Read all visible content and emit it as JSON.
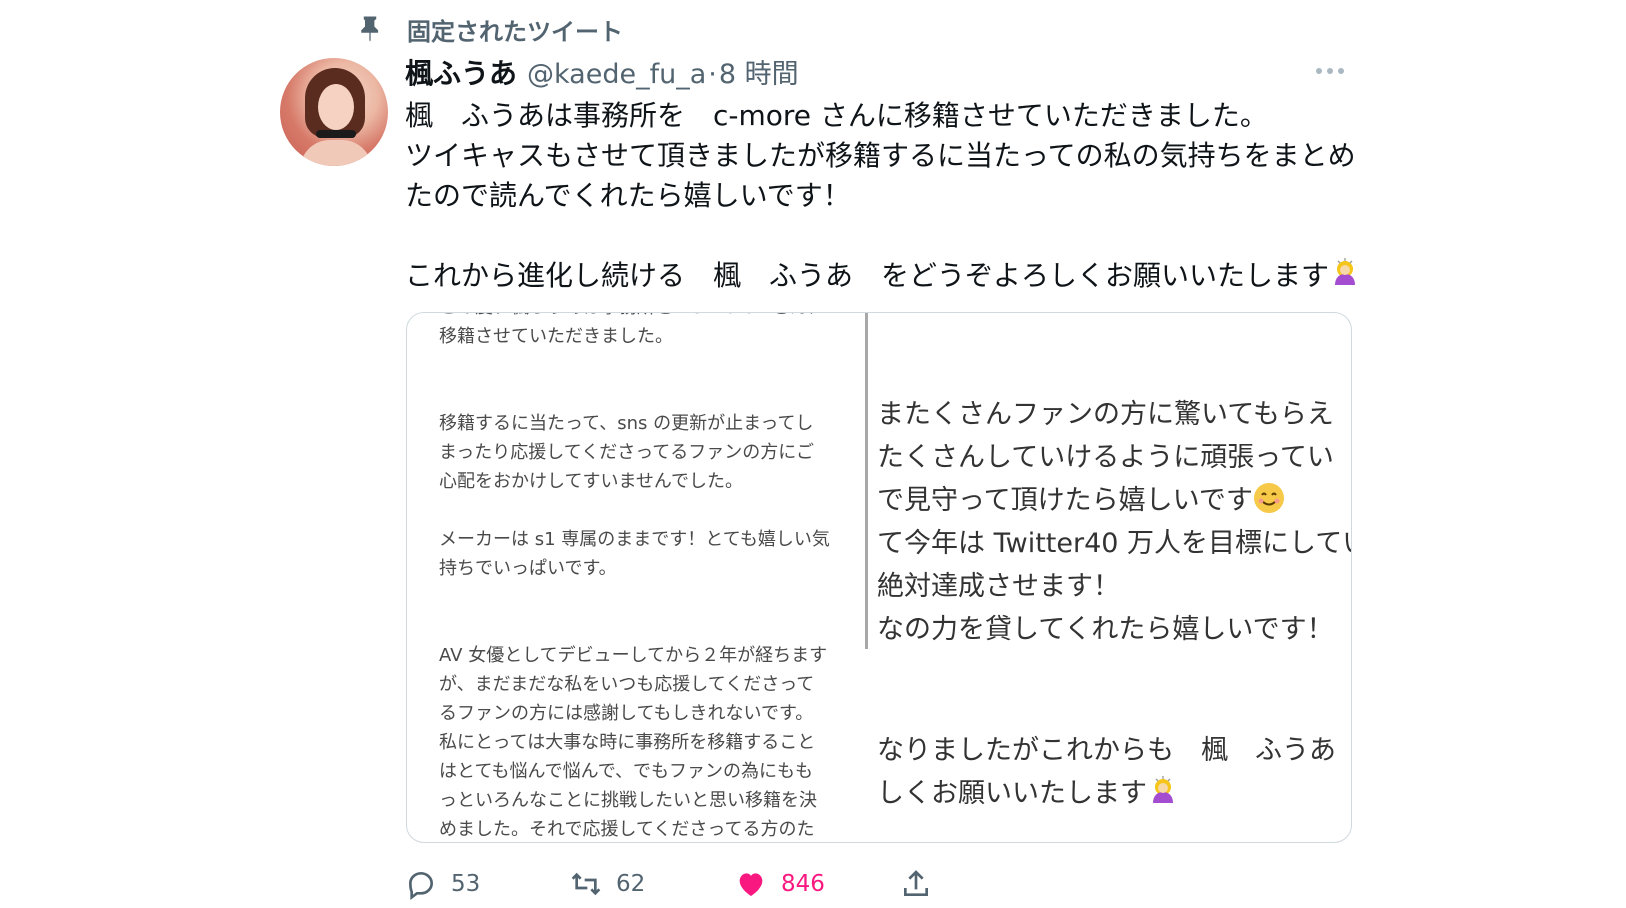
{
  "pinned": {
    "label": "固定されたツイート",
    "icon": "pin-icon"
  },
  "author": {
    "display_name": "楓ふうあ",
    "handle": "@kaede_fu_a",
    "separator": "·",
    "time": "8 時間"
  },
  "tweet": {
    "lines": [
      "楓　ふうあは事務所を　c-more さんに移籍させていただきました。",
      "ツイキャスもさせて頂きましたが移籍するに当たっての私の気持ちをまとめ",
      "たので読んでくれたら嬉しいです！",
      "これから進化し続ける　楓　ふうあ　をどうぞよろしくお願いいたします"
    ],
    "emoji": "woman-bowing-emoji"
  },
  "media": {
    "left_lines": [
      "この度、楓ふうあは事務所を　c-more　さんに",
      "移籍させていただきました。",
      "",
      "",
      "移籍するに当たって、sns の更新が止まってし",
      "まったり応援してくださってるファンの方にご",
      "心配をおかけしてすいませんでした。",
      "",
      "メーカーは s1 専属のままです！とても嬉しい気",
      "持ちでいっぱいです。",
      "",
      "",
      "AV 女優としてデビューしてから２年が経ちます",
      "が、まだまだな私をいつも応援してくださって",
      "るファンの方には感謝してもしきれないです。",
      "私にとっては大事な時に事務所を移籍すること",
      "はとても悩んで悩んで、でもファンの為にもも",
      "っといろんなことに挑戦したいと思い移籍を決",
      "めました。それで応援してくださってる方のた"
    ],
    "right_lines": [
      "またくさんファンの方に驚いてもらえ",
      "たくさんしていけるように頑張ってい",
      "で見守って頂けたら嬉しいです",
      "て今年は Twitter40 万人を目標にしてい",
      "絶対達成させます！",
      "なの力を貸してくれたら嬉しいです！",
      "なりましたがこれからも　楓　ふうあ",
      "しくお願いいたします"
    ]
  },
  "actions": {
    "reply": {
      "icon": "reply-icon",
      "count": "53"
    },
    "retweet": {
      "icon": "retweet-icon",
      "count": "62"
    },
    "like": {
      "icon": "heart-icon",
      "count": "846",
      "color": "#f91880"
    },
    "share": {
      "icon": "share-icon"
    }
  },
  "colors": {
    "secondary_text": "#536471",
    "like": "#f91880",
    "border": "#cfd9de"
  }
}
